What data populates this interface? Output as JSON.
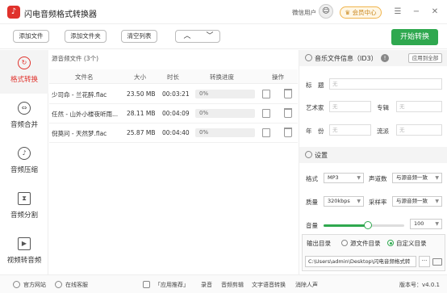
{
  "app": {
    "title": "闪电音频格式转换器",
    "logo_glyph": "♪",
    "wx_user": "微信用户",
    "vip_label": "会员中心",
    "brand_color": "#e0312b",
    "accent_color": "#2fa84f"
  },
  "window_controls": {
    "menu": "☰",
    "minimize": "−",
    "close": "✕"
  },
  "toolbar": {
    "add_file": "添加文件",
    "add_folder": "添加文件夹",
    "clear_list": "清空列表",
    "up": "︿",
    "down": "﹀",
    "start": "开始转换"
  },
  "sidebar": {
    "items": [
      {
        "label": "格式转换",
        "icon": "refresh-icon",
        "glyph": "↻"
      },
      {
        "label": "音频合并",
        "icon": "merge-icon",
        "glyph": "⇔"
      },
      {
        "label": "音频压缩",
        "icon": "compress-icon",
        "glyph": "♪"
      },
      {
        "label": "音频分割",
        "icon": "split-icon",
        "glyph": "⧗"
      },
      {
        "label": "视频转音频",
        "icon": "video-icon",
        "glyph": "▶"
      }
    ]
  },
  "file_list": {
    "source_label": "源音频文件 (3个)",
    "columns": [
      "文件名",
      "大小",
      "时长",
      "转换进度",
      "操作"
    ],
    "rows": [
      {
        "name": "少司命 - 兰花醉.flac",
        "size": "23.50 MB",
        "duration": "00:03:21",
        "progress": "0%"
      },
      {
        "name": "任然 - 山外小楼夜听雨...",
        "size": "28.11 MB",
        "duration": "00:04:09",
        "progress": "0%"
      },
      {
        "name": "倪莫问 - 天然梦.flac",
        "size": "25.87 MB",
        "duration": "00:04:40",
        "progress": "0%"
      }
    ]
  },
  "meta": {
    "header": "音乐文件信息（ID3）",
    "apply_all": "应用到全部",
    "title_label": "标　题",
    "artist_label": "艺术家",
    "album_label": "专辑",
    "year_label": "年　份",
    "genre_label": "流派",
    "empty": "无"
  },
  "settings": {
    "header": "设置",
    "format_label": "格式",
    "format_value": "MP3",
    "channels_label": "声道数",
    "channels_value": "与源音频一致",
    "quality_label": "质量",
    "quality_value": "320kbps",
    "samplerate_label": "采样率",
    "samplerate_value": "与源音频一致",
    "volume_label": "音量",
    "volume_value": "100",
    "volume_fraction": 0.55
  },
  "output": {
    "label": "输出目录",
    "opt_source": "源文件目录",
    "opt_custom": "自定义目录",
    "selected": "自定义目录",
    "path": "C:\\Users\\admin\\Desktop\\闪电音频格式转",
    "browse": "···"
  },
  "status": {
    "website": "官方网站",
    "support": "在线客服",
    "recommend": "「应用推荐」",
    "record": "录音",
    "edit": "音频剪辑",
    "tts": "文字语音转换",
    "vocal": "消除人声",
    "version": "版本号：v4.0.1"
  }
}
